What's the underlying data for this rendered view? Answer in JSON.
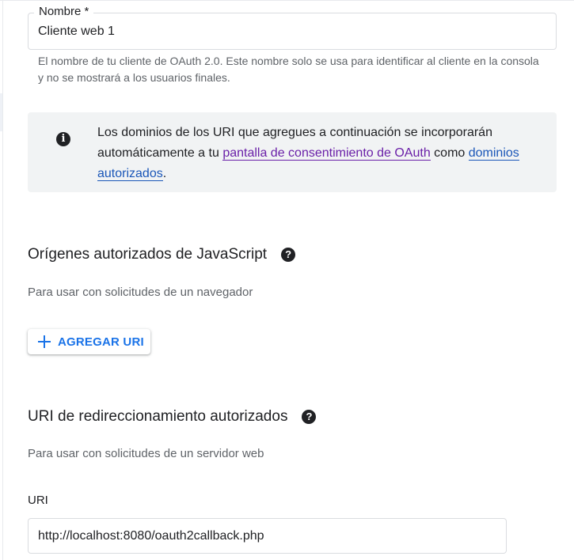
{
  "name_field": {
    "label": "Nombre *",
    "value": "Cliente web 1",
    "helper": "El nombre de tu cliente de OAuth 2.0. Este nombre solo se usa para identificar al cliente en la consola y no se mostrará a los usuarios finales."
  },
  "info": {
    "icon": "info-icon",
    "text_before": "Los dominios de los URI que agregues a continuación se incorporarán automáticamente a tu ",
    "link_consent": "pantalla de consentimiento de OAuth",
    "text_middle": " como ",
    "link_domains": "dominios autorizados",
    "text_after": "."
  },
  "js_origins": {
    "title": "Orígenes autorizados de JavaScript",
    "help_icon": "?",
    "description": "Para usar con solicitudes de un navegador",
    "add_button": "AGREGAR URI"
  },
  "redirect_uris": {
    "title": "URI de redireccionamiento autorizados",
    "help_icon": "?",
    "description": "Para usar con solicitudes de un servidor web",
    "uri_label": "URI",
    "uri_value": "http://localhost:8080/oauth2callback.php"
  },
  "colors": {
    "primary": "#1a73e8",
    "link_visited": "#6a1fa8",
    "info_bg": "#f1f3f4"
  }
}
